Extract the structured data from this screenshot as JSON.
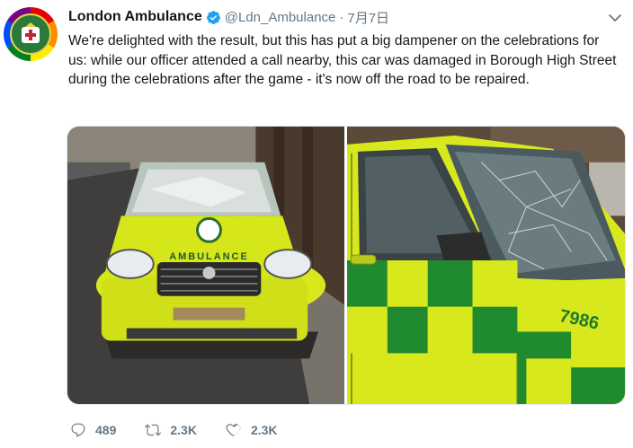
{
  "tweet": {
    "display_name": "London Ambulance",
    "handle": "@Ldn_Ambulance",
    "separator": "·",
    "timestamp": "7月7日",
    "text": "We're delighted with the result, but this has put a big dampener on the celebrations for us: while our officer attended a call nearby, this car was damaged in Borough High Street during the celebrations after the game - it's now off the road to be repaired."
  },
  "media": {
    "left_photo_hood_text": "AMBULANCE",
    "right_photo_number": "7986"
  },
  "actions": {
    "reply_count": "489",
    "retweet_count": "2.3K",
    "like_count": "2.3K"
  },
  "colors": {
    "brand_blue": "#1da1f2",
    "meta_gray": "#657786",
    "ambulance_yellow": "#d7e81c",
    "ambulance_green": "#1f8a2e"
  },
  "icons": [
    "verified-badge-icon",
    "chevron-down-icon",
    "reply-icon",
    "retweet-icon",
    "like-icon"
  ]
}
